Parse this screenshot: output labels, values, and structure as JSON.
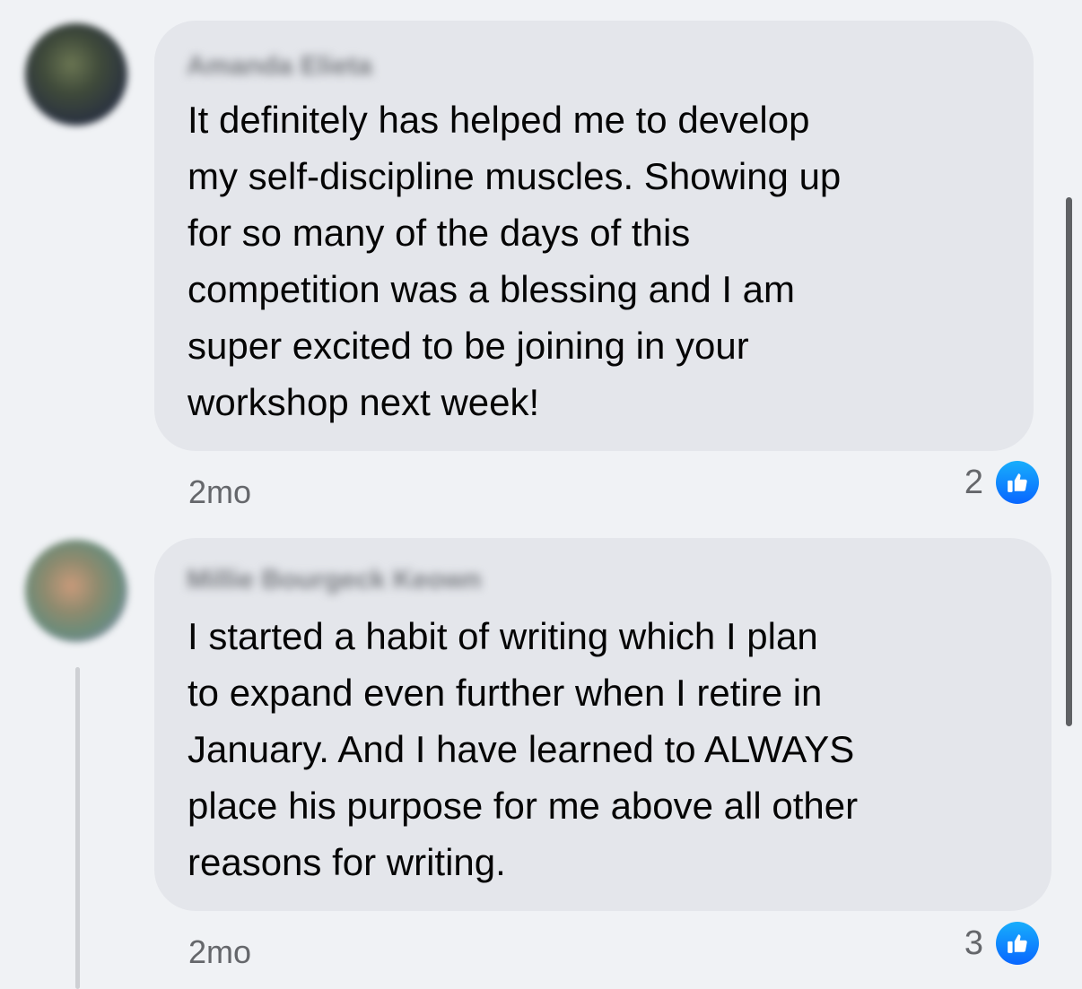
{
  "comments": [
    {
      "author": "Amanda Elieta",
      "text": "It definitely has helped me to develop\nmy self-discipline muscles. Showing up\nfor so many of the days of this\ncompetition was a blessing and I am\nsuper excited to be joining in your\nworkshop next week!",
      "time": "2mo",
      "reaction_count": "2",
      "reaction_icon": "like-icon"
    },
    {
      "author": "Millie Bourgeck Keown",
      "text": "I started a habit of writing which I plan\nto expand even further when I retire in\nJanuary. And I have learned to ALWAYS\nplace his purpose for me above all other\nreasons for writing.",
      "time": "2mo",
      "reaction_count": "3",
      "reaction_icon": "like-icon"
    }
  ],
  "colors": {
    "background": "#f0f2f5",
    "bubble": "#e4e6eb",
    "text": "#050505",
    "meta_text": "#65676b",
    "like_blue": "#0866ff"
  }
}
